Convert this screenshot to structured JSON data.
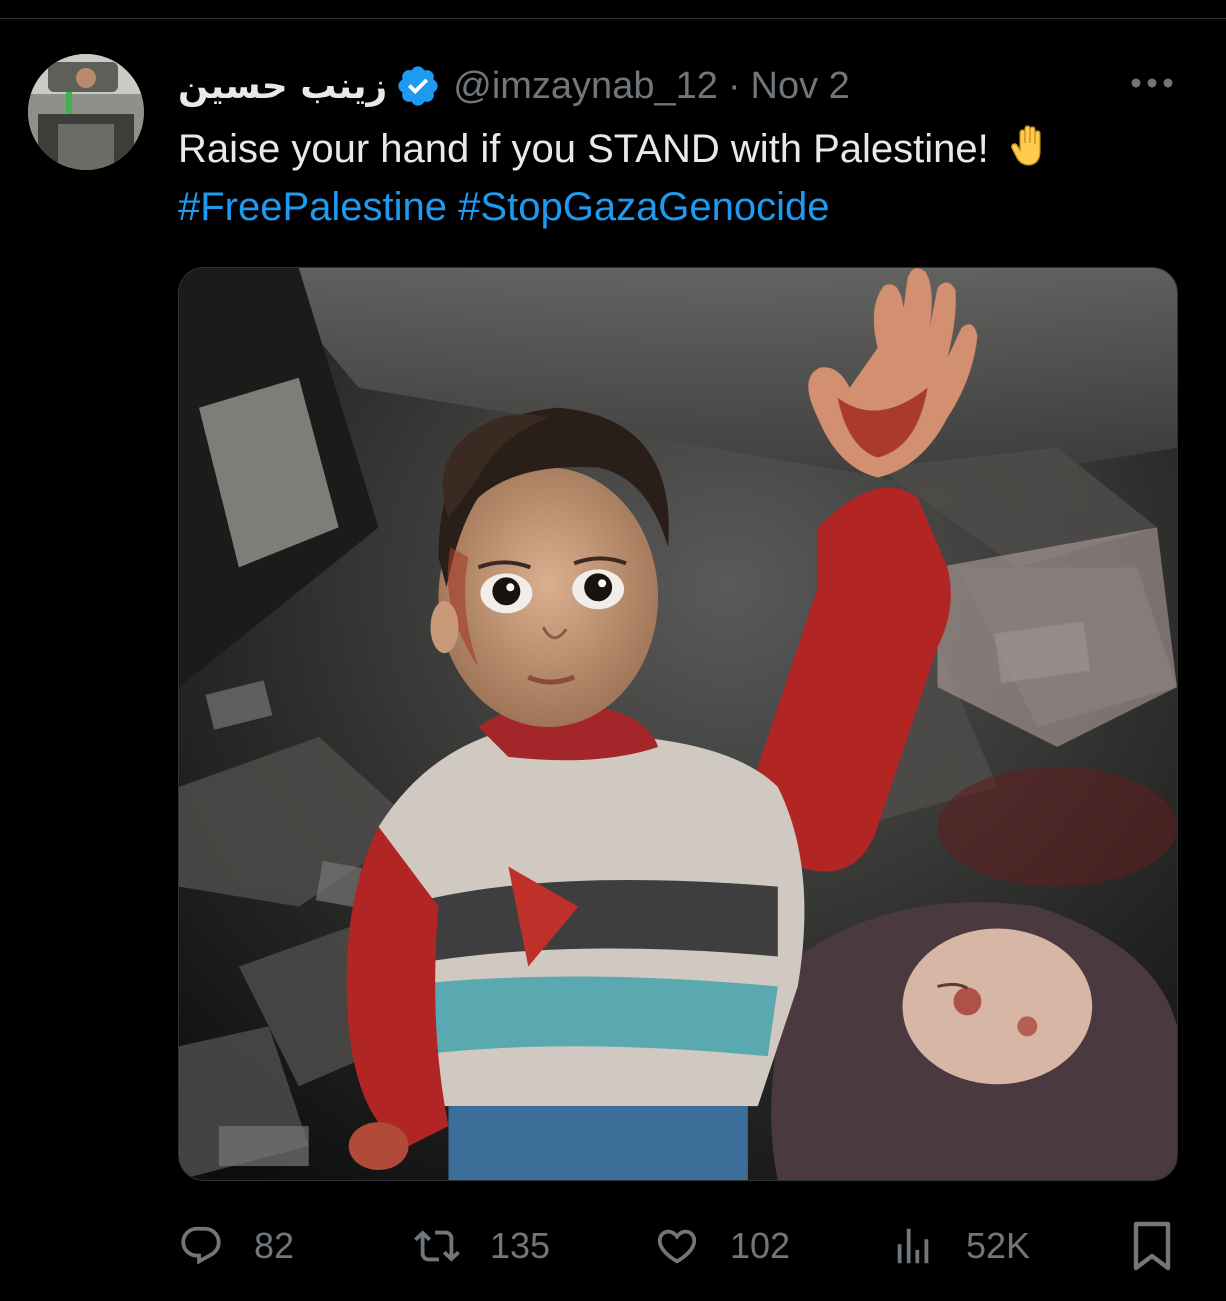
{
  "post": {
    "author": {
      "display_name": "زينب حسين",
      "handle": "@imzaynab_12",
      "verified": true
    },
    "separator": "·",
    "date": "Nov 2",
    "text": "Raise your hand if you STAND with Palestine!",
    "emoji": "✋",
    "hashtags": [
      "#FreePalestine",
      "#StopGazaGenocide"
    ],
    "media": {
      "kind": "photo",
      "subject": "child raising a hand amid rubble"
    }
  },
  "actions": {
    "replies": "82",
    "reposts": "135",
    "likes": "102",
    "views": "52K"
  },
  "colors": {
    "background": "#000000",
    "text": "#e7e9ea",
    "muted": "#71767b",
    "link": "#1d9bf0",
    "verified": "#1d9bf0",
    "divider": "#2f3336"
  },
  "icons": {
    "verified": "verified-badge-icon",
    "more": "more-horizontal-icon",
    "reply": "reply-bubble-icon",
    "repost": "repost-arrows-icon",
    "like": "heart-icon",
    "views": "views-bar-chart-icon",
    "bookmark": "bookmark-icon"
  }
}
